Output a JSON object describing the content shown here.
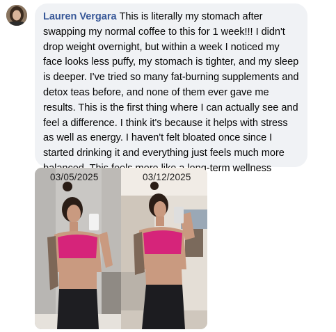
{
  "comment": {
    "author": "Lauren Vergara",
    "text": "This is literally my stomach after swapping my normal coffee to this for 1 week!!! I didn't drop weight overnight, but within a week I noticed my face looks less puffy, my stomach is tighter, and my sleep is deeper. I've tried so many fat-burning supplements and detox teas before, and none of them ever gave me results. This is the first thing where I can actually see and feel a difference. I think it's because it helps with stress as well as energy. I haven't felt bloated once since I started drinking it and everything just feels much more balanced. This feels more like a long-term wellness upgrade than just a coffee swap."
  },
  "photo": {
    "before_date": "03/05/2025",
    "after_date": "03/12/2025"
  },
  "colors": {
    "bubble": "#f0f2f5",
    "author": "#385898",
    "top": "#d6247a"
  }
}
